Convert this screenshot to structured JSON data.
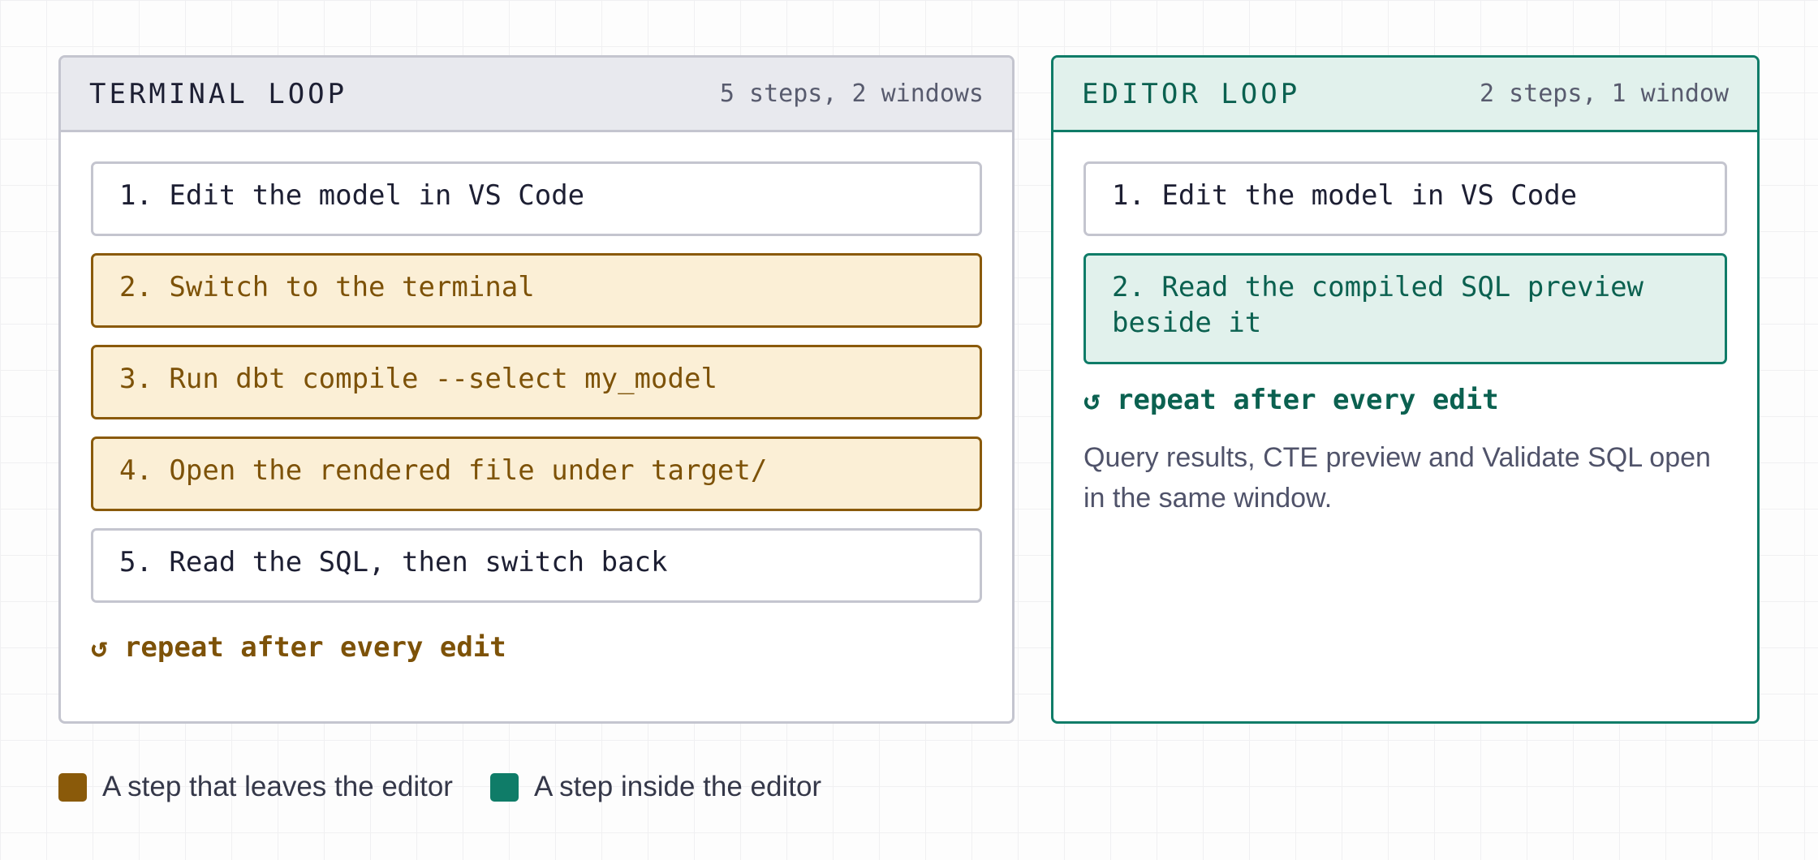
{
  "terminal_loop": {
    "title": "TERMINAL LOOP",
    "meta": "5 steps, 2 windows",
    "steps": [
      {
        "text": "1. Edit the model in VS Code",
        "kind": "neutral"
      },
      {
        "text": "2. Switch to the terminal",
        "kind": "leaves-editor"
      },
      {
        "text": "3. Run dbt compile --select my_model",
        "kind": "leaves-editor"
      },
      {
        "text": "4. Open the rendered file under target/",
        "kind": "leaves-editor"
      },
      {
        "text": "5. Read the SQL, then switch back",
        "kind": "neutral"
      }
    ],
    "repeat_label": "↺ repeat after every edit"
  },
  "editor_loop": {
    "title": "EDITOR LOOP",
    "meta": "2 steps, 1 window",
    "steps": [
      {
        "text": "1. Edit the model in VS Code",
        "kind": "neutral"
      },
      {
        "text": "2. Read the compiled SQL preview beside it",
        "kind": "inside-editor"
      }
    ],
    "repeat_label": "↺ repeat after every edit",
    "note": "Query results, CTE preview and Validate SQL open in the same window."
  },
  "legend": [
    {
      "label": "A step that leaves the editor",
      "color": "#8a5a0a"
    },
    {
      "label": "A step inside the editor",
      "color": "#0f7c68"
    }
  ]
}
